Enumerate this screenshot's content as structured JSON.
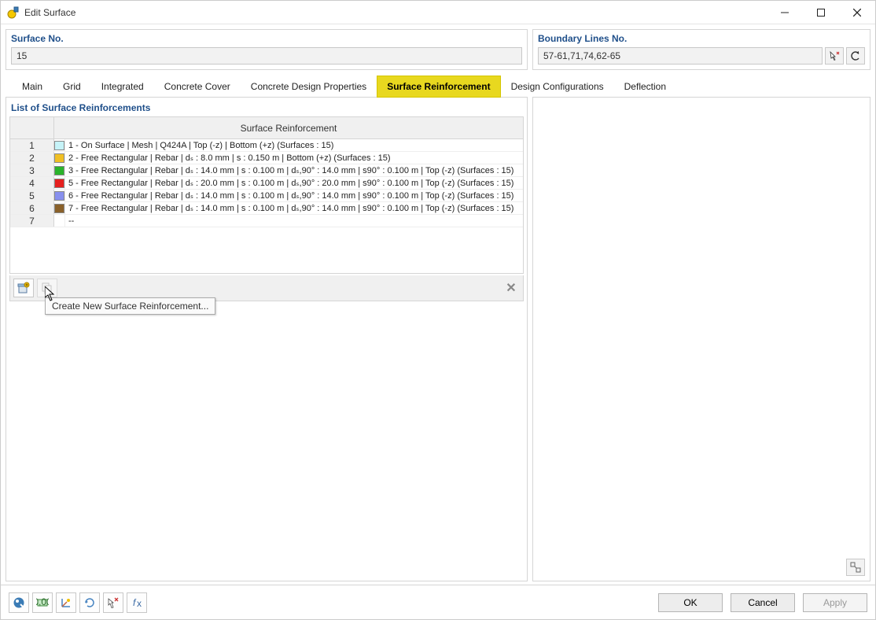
{
  "window": {
    "title": "Edit Surface"
  },
  "fields": {
    "surface_no_label": "Surface No.",
    "surface_no_value": "15",
    "boundary_label": "Boundary Lines No.",
    "boundary_value": "57-61,71,74,62-65"
  },
  "tabs": [
    {
      "label": "Main"
    },
    {
      "label": "Grid"
    },
    {
      "label": "Integrated"
    },
    {
      "label": "Concrete Cover"
    },
    {
      "label": "Concrete Design Properties"
    },
    {
      "label": "Surface Reinforcement",
      "active": true
    },
    {
      "label": "Design Configurations"
    },
    {
      "label": "Deflection"
    }
  ],
  "panel": {
    "title": "List of Surface Reinforcements",
    "column": "Surface Reinforcement",
    "rows": [
      {
        "n": "1",
        "color": "#c6f3f8",
        "text": "1 - On Surface | Mesh | Q424A | Top (-z) | Bottom (+z) (Surfaces : 15)"
      },
      {
        "n": "2",
        "color": "#f0bf24",
        "text": "2 - Free Rectangular | Rebar | dₛ : 8.0 mm | s : 0.150 m | Bottom (+z) (Surfaces : 15)"
      },
      {
        "n": "3",
        "color": "#2bb32b",
        "text": "3 - Free Rectangular | Rebar | dₛ : 14.0 mm | s : 0.100 m | dₛ,90° : 14.0 mm | s90° : 0.100 m | Top (-z) (Surfaces : 15)"
      },
      {
        "n": "4",
        "color": "#e5201f",
        "text": "5 - Free Rectangular | Rebar | dₛ : 20.0 mm | s : 0.100 m | dₛ,90° : 20.0 mm | s90° : 0.100 m | Top (-z) (Surfaces : 15)"
      },
      {
        "n": "5",
        "color": "#8890ee",
        "text": "6 - Free Rectangular | Rebar | dₛ : 14.0 mm | s : 0.100 m | dₛ,90° : 14.0 mm | s90° : 0.100 m | Top (-z) (Surfaces : 15)"
      },
      {
        "n": "6",
        "color": "#8a612a",
        "text": "7 - Free Rectangular | Rebar | dₛ : 14.0 mm | s : 0.100 m | dₛ,90° : 14.0 mm | s90° : 0.100 m | Top (-z) (Surfaces : 15)"
      },
      {
        "n": "7",
        "color": "",
        "text": "--"
      }
    ],
    "tooltip": "Create New Surface Reinforcement..."
  },
  "footer": {
    "ok": "OK",
    "cancel": "Cancel",
    "apply": "Apply"
  }
}
